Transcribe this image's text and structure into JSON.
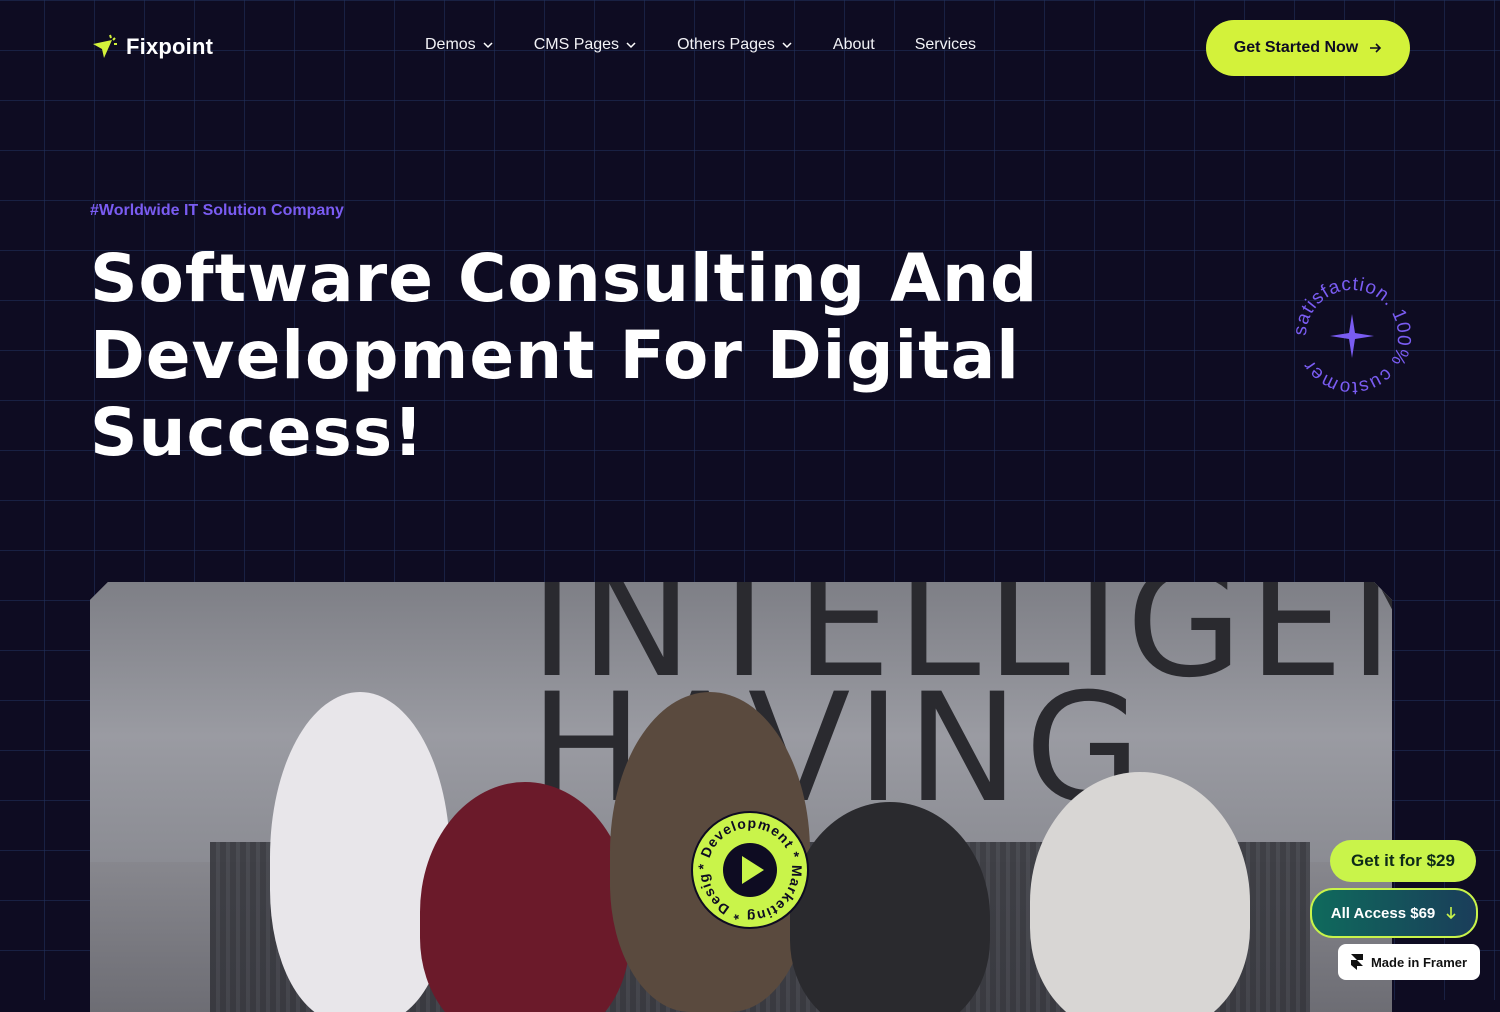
{
  "brand": {
    "name": "Fixpoint",
    "accent": "#d3f23a",
    "purple": "#7a5cf2",
    "background": "#0e0c22"
  },
  "nav": {
    "items": [
      {
        "label": "Demos",
        "has_dropdown": true
      },
      {
        "label": "CMS Pages",
        "has_dropdown": true
      },
      {
        "label": "Others Pages",
        "has_dropdown": true
      },
      {
        "label": "About",
        "has_dropdown": false
      },
      {
        "label": "Services",
        "has_dropdown": false
      }
    ],
    "cta_label": "Get Started Now"
  },
  "hero": {
    "tagline": "#Worldwide IT Solution Company",
    "title": "Software Consulting And Development For Digital Success!",
    "badge_text": "satisfaction. 100% customer",
    "play_badge_text": "* Development * Marketing * Design",
    "image_wall_text": "INTELLIGEN HAVING"
  },
  "floating": {
    "buy_label": "Get it for $29",
    "all_access_label": "All Access $69",
    "framer_label": "Made in Framer"
  }
}
